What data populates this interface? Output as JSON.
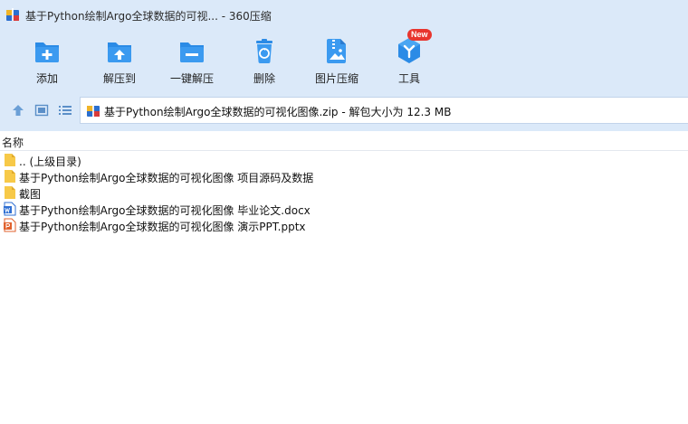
{
  "window": {
    "title": "基于Python绘制Argo全球数据的可视... - 360压缩"
  },
  "toolbar": {
    "items": [
      {
        "label": "添加",
        "icon": "add-folder-icon"
      },
      {
        "label": "解压到",
        "icon": "extract-to-icon"
      },
      {
        "label": "一键解压",
        "icon": "one-click-extract-icon"
      },
      {
        "label": "删除",
        "icon": "delete-icon"
      },
      {
        "label": "图片压缩",
        "icon": "image-compress-icon"
      },
      {
        "label": "工具",
        "icon": "tools-icon",
        "badge": "New"
      }
    ]
  },
  "navigation": {
    "path": "基于Python绘制Argo全球数据的可视化图像.zip - 解包大小为 12.3 MB"
  },
  "list": {
    "column_name": "名称",
    "rows": [
      {
        "name": ".. (上级目录)",
        "icon": "folder-icon"
      },
      {
        "name": "基于Python绘制Argo全球数据的可视化图像 项目源码及数据",
        "icon": "folder-icon"
      },
      {
        "name": "截图",
        "icon": "folder-icon"
      },
      {
        "name": "基于Python绘制Argo全球数据的可视化图像 毕业论文.docx",
        "icon": "word-doc-icon"
      },
      {
        "name": "基于Python绘制Argo全球数据的可视化图像 演示PPT.pptx",
        "icon": "powerpoint-icon"
      }
    ]
  },
  "colors": {
    "header_bg": "#dbe9f9",
    "toolbar_icon_blue": "#2b8be6",
    "badge_red": "#e8352e",
    "folder_yellow": "#f7c948",
    "word_blue": "#2f6fd3",
    "ppt_orange": "#e0622e"
  }
}
